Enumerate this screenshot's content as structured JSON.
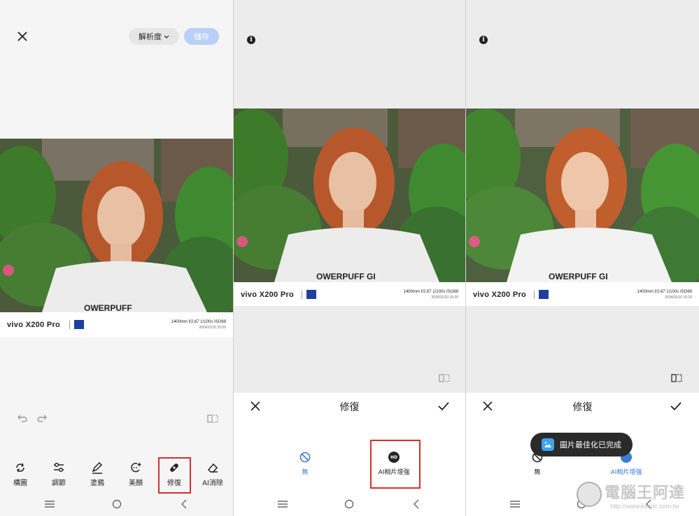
{
  "panel1": {
    "resolution_label": "解析度",
    "save_label": "儲存",
    "watermark": {
      "brand": "vivo X200 Pro",
      "specs": "1400mm  f/2.67  1/100s  ISO69",
      "date": "2024/11/10 15:20"
    },
    "tools": [
      {
        "label": "構圖",
        "icon": "crop-rotate-icon"
      },
      {
        "label": "調節",
        "icon": "sliders-icon"
      },
      {
        "label": "塗鴉",
        "icon": "pen-icon"
      },
      {
        "label": "美顏",
        "icon": "face-retouch-icon"
      },
      {
        "label": "修復",
        "icon": "bandage-icon"
      },
      {
        "label": "AI消除",
        "icon": "eraser-icon"
      }
    ]
  },
  "panel2": {
    "sheet_title": "修復",
    "watermark": {
      "brand": "vivo X200 Pro",
      "specs": "1400mm  f/2.67  1/100s  ISO69",
      "date": "2024/11/10 15:20"
    },
    "options": [
      {
        "label": "無",
        "icon": "none-icon"
      },
      {
        "label": "AI相片增強",
        "icon": "hd-icon",
        "badge": "HD"
      }
    ]
  },
  "panel3": {
    "sheet_title": "修復",
    "toast": "圖片最佳化已完成",
    "watermark": {
      "brand": "vivo X200 Pro",
      "specs": "1400mm  f/2.67  1/100s  ISO69",
      "date": "2024/11/10 15:20"
    },
    "options": [
      {
        "label": "無",
        "icon": "none-icon"
      },
      {
        "label": "AI相片增強",
        "icon": "hd-icon"
      }
    ]
  },
  "site_watermark": {
    "name": "電腦王阿達",
    "url": "http://www.kocpc.com.tw"
  },
  "colors": {
    "accent": "#3a7bd5",
    "highlight_box": "#d32f2f",
    "save_disabled": "#b9cff5"
  }
}
